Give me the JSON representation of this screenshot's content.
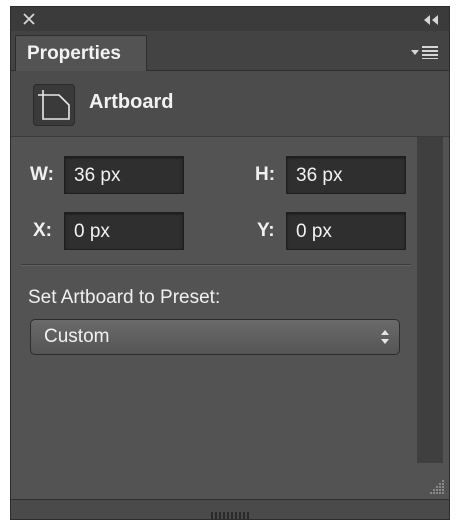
{
  "panel": {
    "tab_label": "Properties",
    "header_title": "Artboard"
  },
  "fields": {
    "w": {
      "label": "W:",
      "value": "36 px"
    },
    "h": {
      "label": "H:",
      "value": "36 px"
    },
    "x": {
      "label": "X:",
      "value": "0 px"
    },
    "y": {
      "label": "Y:",
      "value": "0 px"
    }
  },
  "preset": {
    "label": "Set Artboard to Preset:",
    "selected": "Custom"
  },
  "icons": {
    "close": "close-icon",
    "collapse": "double-chevron-left-icon",
    "panel_menu": "panel-menu-icon",
    "artboard": "artboard-icon",
    "select_arrows": "updown-arrows-icon",
    "resize": "resize-grip-icon"
  },
  "colors": {
    "panel_bg": "#535353",
    "field_bg": "#2f2f2f",
    "text": "#f2f2f2"
  }
}
